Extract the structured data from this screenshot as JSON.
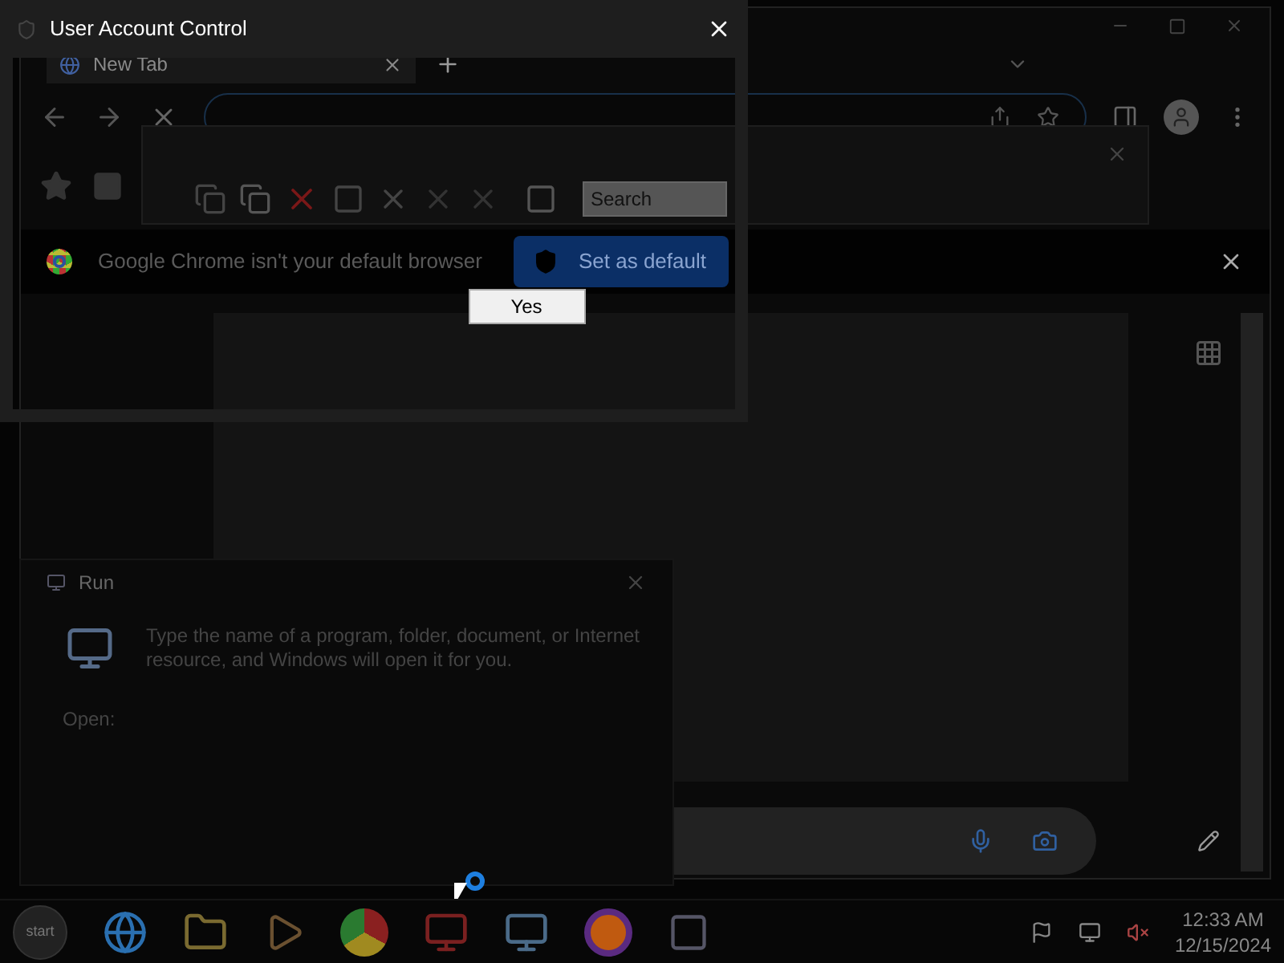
{
  "uac_window": {
    "title": "User Account Control"
  },
  "browser": {
    "tabs": [
      {
        "label": "New Tab",
        "selected": true
      }
    ],
    "infobar": {
      "message": "Google Chrome isn't your default browser",
      "button": "Set as default"
    }
  },
  "inner_dialog": {
    "search": {
      "placeholder": "Search"
    }
  },
  "confirm_button": "Yes",
  "run_dialog": {
    "title": "Run",
    "description": "Type the name of a program, folder, document, or Internet resource, and Windows will open it for you.",
    "open_label": "Open:"
  },
  "taskbar": {
    "start": "start",
    "time": "12:33 AM",
    "date": "12/15/2024"
  }
}
